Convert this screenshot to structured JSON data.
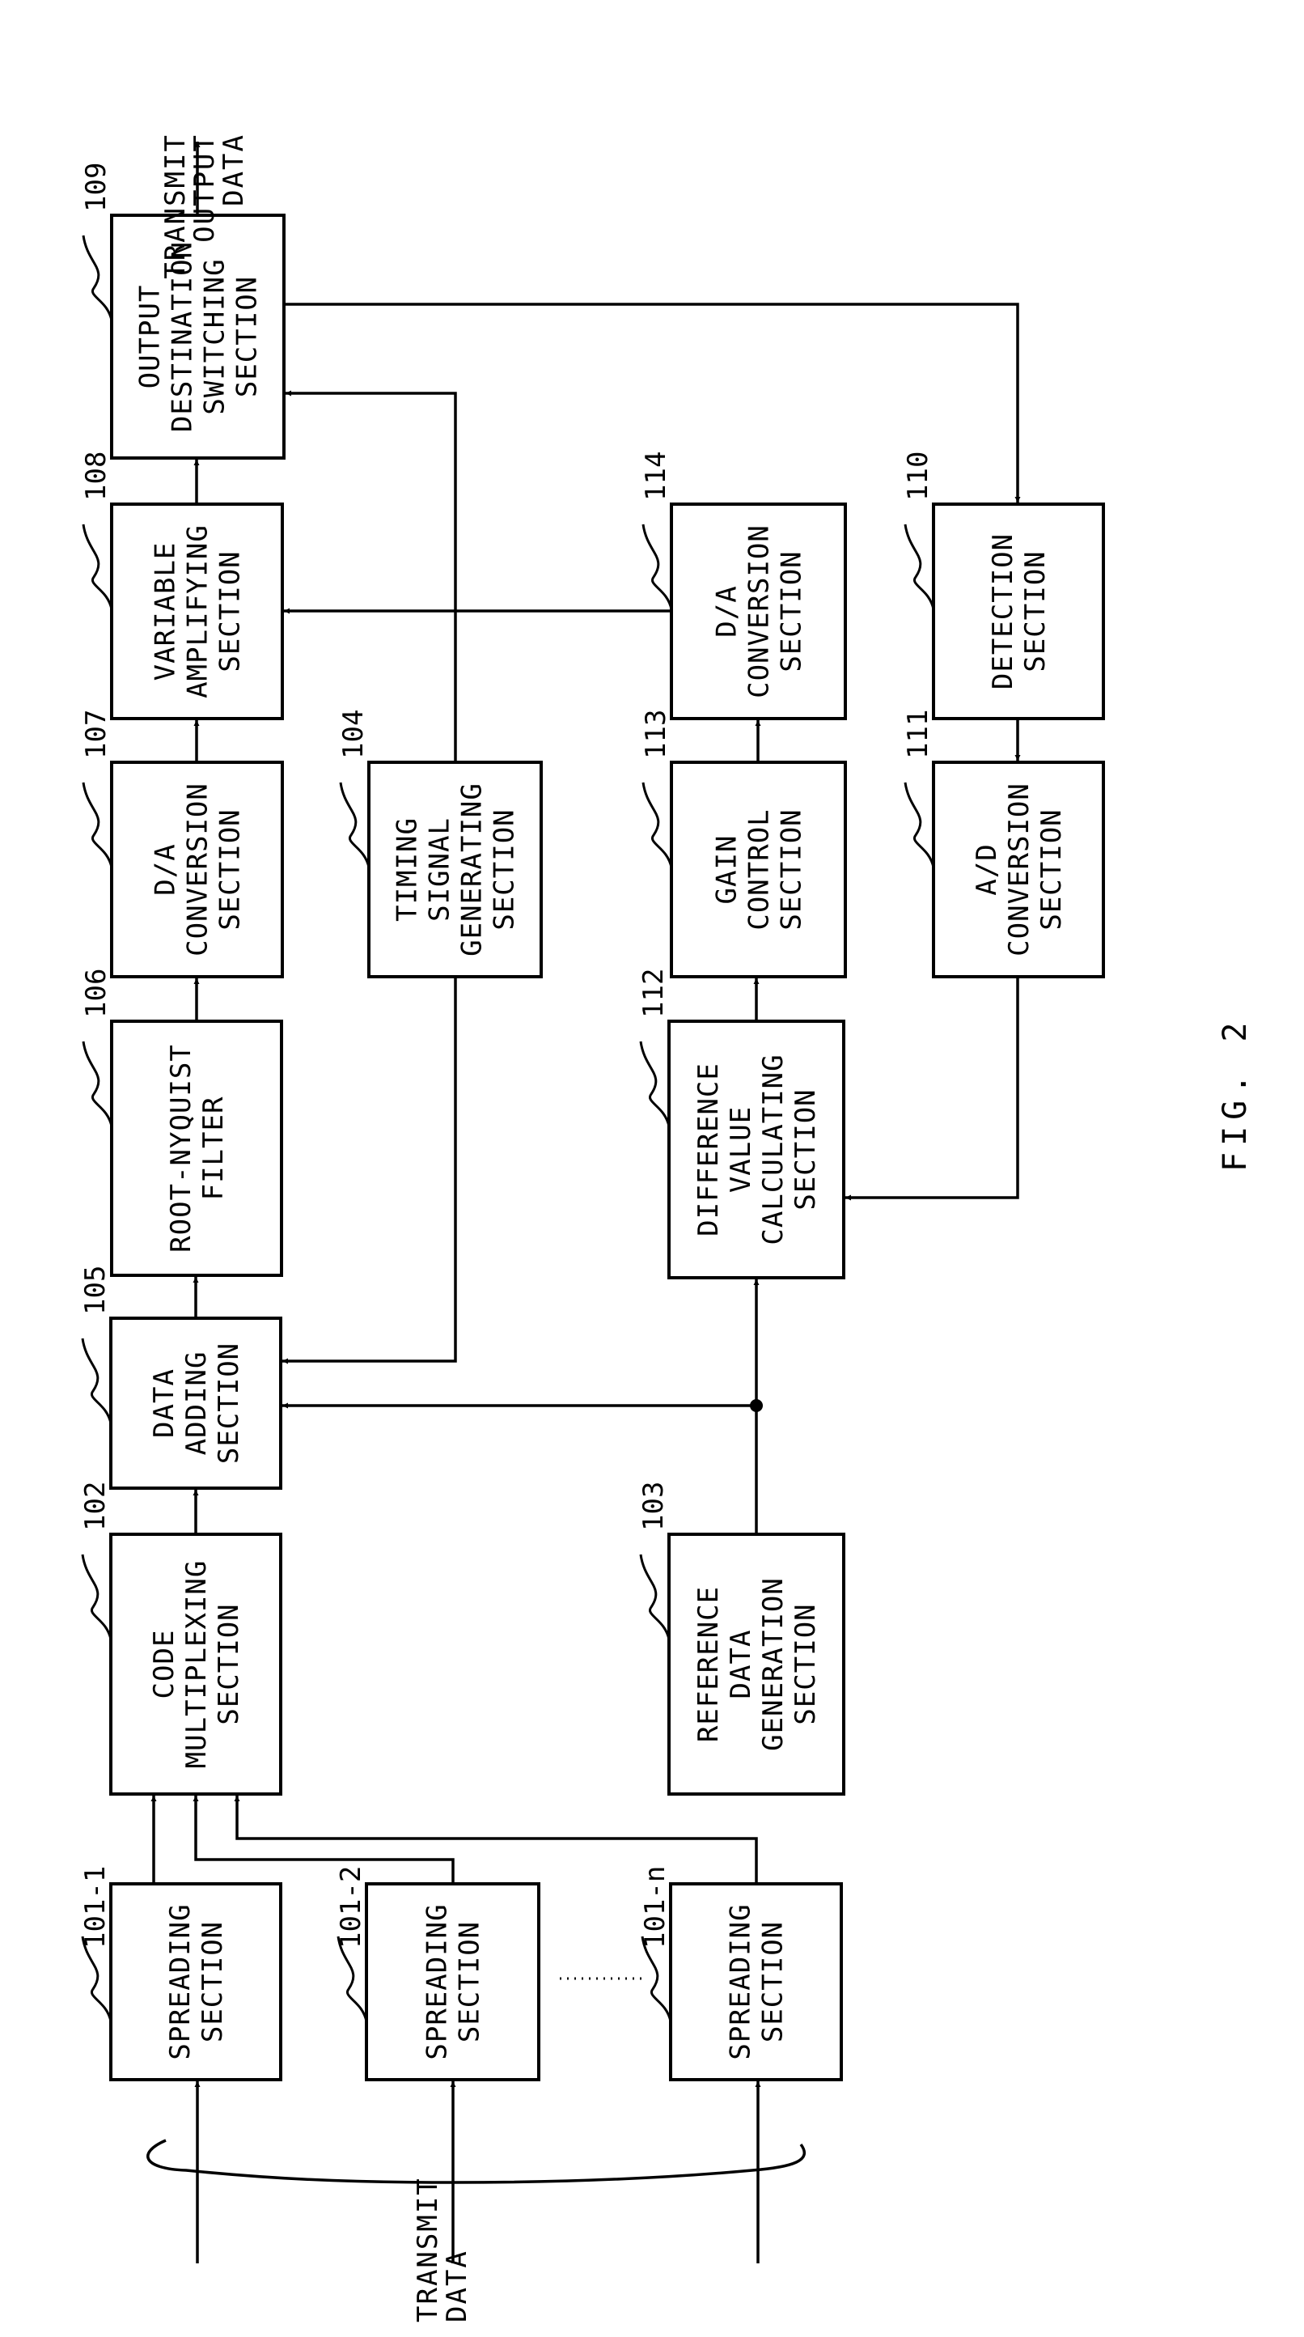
{
  "figure": {
    "label": "FIG. 2",
    "input_label": [
      "TRANSMIT",
      "DATA"
    ],
    "output_label": [
      "TRANSMIT",
      "OUTPUT",
      "DATA"
    ],
    "ellipsis": "......",
    "colors": {
      "ink": "#000000",
      "paper": "#ffffff"
    }
  },
  "blocks": [
    {
      "id": "101-1",
      "ref": "101-1",
      "lines": [
        "SPREADING",
        "SECTION"
      ]
    },
    {
      "id": "101-2",
      "ref": "101-2",
      "lines": [
        "SPREADING",
        "SECTION"
      ]
    },
    {
      "id": "101-n",
      "ref": "101-n",
      "lines": [
        "SPREADING",
        "SECTION"
      ]
    },
    {
      "id": "102",
      "ref": "102",
      "lines": [
        "CODE",
        "MULTIPLEXING",
        "SECTION"
      ]
    },
    {
      "id": "103",
      "ref": "103",
      "lines": [
        "REFERENCE",
        "DATA",
        "GENERATION",
        "SECTION"
      ]
    },
    {
      "id": "104",
      "ref": "104",
      "lines": [
        "TIMING",
        "SIGNAL",
        "GENERATING",
        "SECTION"
      ]
    },
    {
      "id": "105",
      "ref": "105",
      "lines": [
        "DATA",
        "ADDING",
        "SECTION"
      ]
    },
    {
      "id": "106",
      "ref": "106",
      "lines": [
        "ROOT-NYQUIST",
        "FILTER"
      ]
    },
    {
      "id": "107",
      "ref": "107",
      "lines": [
        "D/A",
        "CONVERSION",
        "SECTION"
      ]
    },
    {
      "id": "108",
      "ref": "108",
      "lines": [
        "VARIABLE",
        "AMPLIFYING",
        "SECTION"
      ]
    },
    {
      "id": "109",
      "ref": "109",
      "lines": [
        "OUTPUT",
        "DESTINATION",
        "SWITCHING",
        "SECTION"
      ]
    },
    {
      "id": "110",
      "ref": "110",
      "lines": [
        "DETECTION",
        "SECTION"
      ]
    },
    {
      "id": "111",
      "ref": "111",
      "lines": [
        "A/D",
        "CONVERSION",
        "SECTION"
      ]
    },
    {
      "id": "112",
      "ref": "112",
      "lines": [
        "DIFFERENCE",
        "VALUE",
        "CALCULATING",
        "SECTION"
      ]
    },
    {
      "id": "113",
      "ref": "113",
      "lines": [
        "GAIN",
        "CONTROL",
        "SECTION"
      ]
    },
    {
      "id": "114",
      "ref": "114",
      "lines": [
        "D/A",
        "CONVERSION",
        "SECTION"
      ]
    }
  ],
  "connections": [
    {
      "from": "TRANSMIT DATA",
      "to": "101-1"
    },
    {
      "from": "TRANSMIT DATA",
      "to": "101-2"
    },
    {
      "from": "TRANSMIT DATA",
      "to": "101-n"
    },
    {
      "from": "101-1",
      "to": "102"
    },
    {
      "from": "101-2",
      "to": "102"
    },
    {
      "from": "101-n",
      "to": "102"
    },
    {
      "from": "102",
      "to": "105"
    },
    {
      "from": "103",
      "to": "105"
    },
    {
      "from": "103",
      "to": "112"
    },
    {
      "from": "104",
      "to": "105"
    },
    {
      "from": "104",
      "to": "109"
    },
    {
      "from": "105",
      "to": "106"
    },
    {
      "from": "106",
      "to": "107"
    },
    {
      "from": "107",
      "to": "108"
    },
    {
      "from": "108",
      "to": "109"
    },
    {
      "from": "109",
      "to": "TRANSMIT OUTPUT DATA"
    },
    {
      "from": "109",
      "to": "110"
    },
    {
      "from": "110",
      "to": "111"
    },
    {
      "from": "111",
      "to": "112"
    },
    {
      "from": "112",
      "to": "113"
    },
    {
      "from": "113",
      "to": "114"
    },
    {
      "from": "114",
      "to": "108"
    }
  ]
}
